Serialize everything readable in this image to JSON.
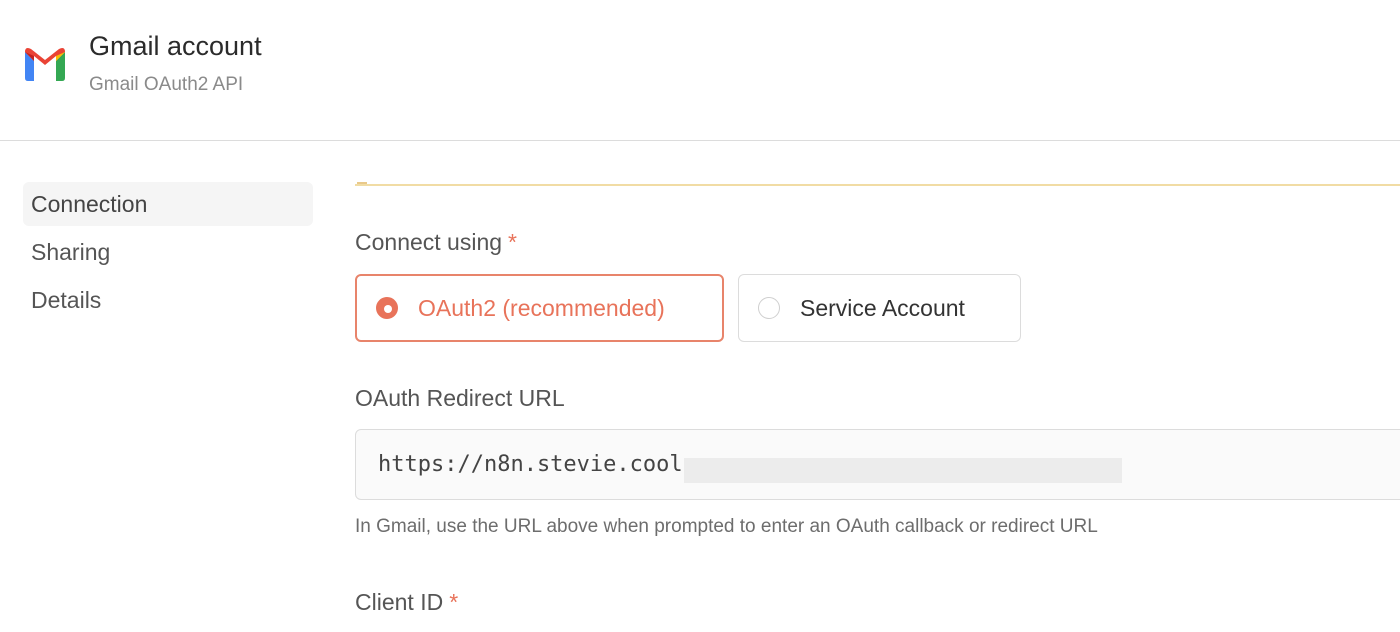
{
  "header": {
    "title": "Gmail account",
    "subtitle": "Gmail OAuth2 API",
    "logo": "gmail-logo"
  },
  "sidebar": {
    "items": [
      {
        "label": "Connection",
        "active": true
      },
      {
        "label": "Sharing",
        "active": false
      },
      {
        "label": "Details",
        "active": false
      }
    ]
  },
  "form": {
    "connect_using": {
      "label": "Connect using",
      "required_mark": "*",
      "options": [
        {
          "label": "OAuth2 (recommended)",
          "selected": true
        },
        {
          "label": "Service Account",
          "selected": false
        }
      ]
    },
    "redirect_url": {
      "label": "OAuth Redirect URL",
      "value": "https://n8n.stevie.cool",
      "hint": "In Gmail, use the URL above when prompted to enter an OAuth callback or redirect URL"
    },
    "client_id": {
      "label": "Client ID",
      "required_mark": "*"
    }
  },
  "colors": {
    "accent": "#e8735a",
    "border": "#dcdcdc",
    "notice_line": "#f1dca4"
  }
}
